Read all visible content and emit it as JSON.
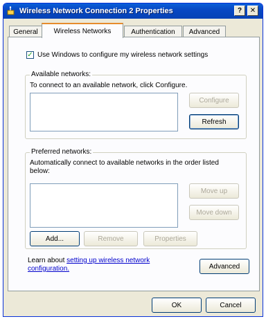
{
  "window": {
    "title": "Wireless Network Connection 2 Properties",
    "help_label": "?",
    "close_label": "✕"
  },
  "tabs": [
    {
      "label": "General",
      "active": false
    },
    {
      "label": "Wireless Networks",
      "active": true
    },
    {
      "label": "Authentication",
      "active": false
    },
    {
      "label": "Advanced",
      "active": false
    }
  ],
  "config_checkbox": {
    "label": "Use Windows to configure my wireless network settings",
    "checked": true,
    "mark": "✓"
  },
  "available": {
    "title": "Available networks:",
    "description": "To connect to an available network, click Configure.",
    "configure_label": "Configure",
    "refresh_label": "Refresh"
  },
  "preferred": {
    "title": "Preferred networks:",
    "description_line1": "Automatically connect to available networks in the order listed",
    "description_line2": "below:",
    "move_up_label": "Move up",
    "move_down_label": "Move down",
    "add_label": "Add...",
    "remove_label": "Remove",
    "properties_label": "Properties"
  },
  "learn": {
    "prefix": "Learn about ",
    "link_text": "setting up wireless network configuration.",
    "advanced_label": "Advanced"
  },
  "footer": {
    "ok_label": "OK",
    "cancel_label": "Cancel"
  },
  "colors": {
    "titlebar": "#0842c0",
    "dialog_bg": "#ece9d8",
    "link": "#0000cc",
    "checkmark": "#21a121"
  }
}
